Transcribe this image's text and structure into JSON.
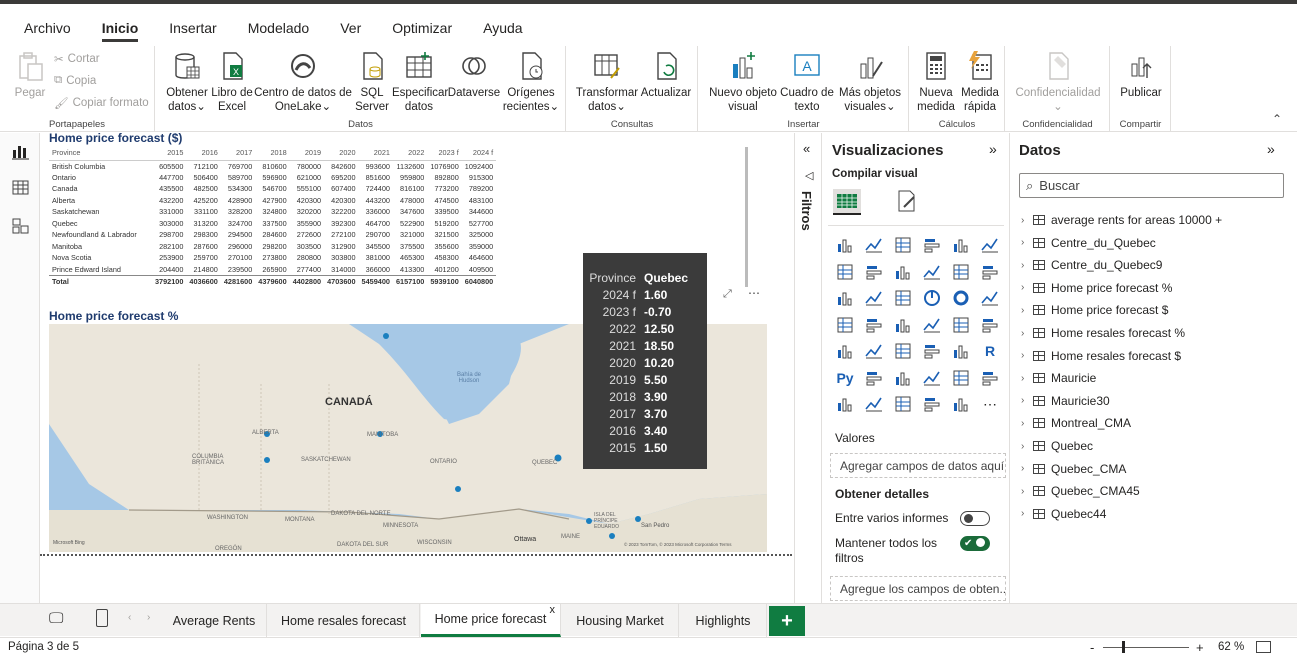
{
  "menu": [
    "Archivo",
    "Inicio",
    "Insertar",
    "Modelado",
    "Ver",
    "Optimizar",
    "Ayuda"
  ],
  "ribbon": {
    "portapapeles": {
      "label": "Portapapeles",
      "pegar": "Pegar",
      "cortar": "Cortar",
      "copia": "Copia",
      "copiar_formato": "Copiar formato"
    },
    "datos": {
      "label": "Datos",
      "obtener": "Obtener datos",
      "libro": "Libro de Excel",
      "centro": "Centro de datos de OneLake",
      "sql": "SQL Server",
      "especificar": "Especificar datos",
      "dataverse": "Dataverse",
      "origenes": "Orígenes recientes"
    },
    "consultas": {
      "label": "Consultas",
      "transformar": "Transformar datos",
      "actualizar": "Actualizar"
    },
    "insertar": {
      "label": "Insertar",
      "nuevo": "Nuevo objeto visual",
      "cuadro": "Cuadro de texto",
      "mas": "Más objetos visuales"
    },
    "calculos": {
      "label": "Cálculos",
      "nueva_medida": "Nueva medida",
      "medida_rapida": "Medida rápida"
    },
    "confidencialidad": {
      "label": "Confidencialidad",
      "btn": "Confidencialidad"
    },
    "compartir": {
      "label": "Compartir",
      "publicar": "Publicar"
    }
  },
  "table": {
    "title": "Home price forecast ($)",
    "headers": [
      "Province",
      "2015",
      "2016",
      "2017",
      "2018",
      "2019",
      "2020",
      "2021",
      "2022",
      "2023 f",
      "2024 f"
    ],
    "rows": [
      [
        "British Columbia",
        "605500",
        "712100",
        "769700",
        "810600",
        "780000",
        "842600",
        "993600",
        "1132600",
        "1076900",
        "1092400"
      ],
      [
        "Ontario",
        "447700",
        "506400",
        "589700",
        "596900",
        "621000",
        "695200",
        "851600",
        "959800",
        "892800",
        "915300"
      ],
      [
        "Canada",
        "435500",
        "482500",
        "534300",
        "546700",
        "555100",
        "607400",
        "724400",
        "816100",
        "773200",
        "789200"
      ],
      [
        "Alberta",
        "432200",
        "425200",
        "428900",
        "427900",
        "420300",
        "420300",
        "443200",
        "478000",
        "474500",
        "483100"
      ],
      [
        "Saskatchewan",
        "331000",
        "331100",
        "328200",
        "324800",
        "320200",
        "322200",
        "336000",
        "347600",
        "339500",
        "344600"
      ],
      [
        "Quebec",
        "303000",
        "313200",
        "324700",
        "337500",
        "355900",
        "392300",
        "464700",
        "522900",
        "519200",
        "527700"
      ],
      [
        "Newfoundland & Labrador",
        "298700",
        "298300",
        "294500",
        "284600",
        "272600",
        "272100",
        "290700",
        "321000",
        "321500",
        "325000"
      ],
      [
        "Manitoba",
        "282100",
        "287600",
        "296000",
        "298200",
        "303500",
        "312900",
        "345500",
        "375500",
        "355600",
        "359000"
      ],
      [
        "Nova Scotia",
        "253900",
        "259700",
        "270100",
        "273800",
        "280800",
        "303800",
        "381000",
        "465300",
        "458300",
        "464600"
      ],
      [
        "Prince Edward Island",
        "204400",
        "214800",
        "239500",
        "265900",
        "277400",
        "314000",
        "366000",
        "413300",
        "401200",
        "409500"
      ]
    ],
    "total": [
      "Total",
      "3792100",
      "4036600",
      "4281600",
      "4379600",
      "4402800",
      "4703600",
      "5459400",
      "6157100",
      "5939100",
      "6040800"
    ]
  },
  "map": {
    "title": "Home price forecast %",
    "labels": {
      "canada": "CANADÁ",
      "alberta": "ALBERTA",
      "manitoba": "MANITOBA",
      "sask": "SASKATCHEWAN",
      "ontario": "ONTARIO",
      "quebec": "QUEBEC",
      "bc": "COLUMBIA BRITÁNICA",
      "hudson": "Bahía de Hudson",
      "washington": "WASHINGTON",
      "montana": "MONTANA",
      "dakota_n": "DAKOTA DEL NORTE",
      "dakota_s": "DAKOTA DEL SUR",
      "minnesota": "MINNESOTA",
      "wisconsin": "WISCONSIN",
      "oregon": "OREGÓN",
      "maine": "MAINE",
      "ottawa": "Ottawa",
      "pei": "ISLA DEL PRÍNCIPE EDUARDO",
      "sanpedro": "San Pedro",
      "bing": "Microsoft Bing",
      "copyright": "© 2023 TomTom, © 2023 Microsoft Corporation  Terms"
    }
  },
  "tooltip": {
    "province_label": "Province",
    "province": "Quebec",
    "rows": [
      [
        "2024 f",
        "1.60"
      ],
      [
        "2023 f",
        "-0.70"
      ],
      [
        "2022",
        "12.50"
      ],
      [
        "2021",
        "18.50"
      ],
      [
        "2020",
        "10.20"
      ],
      [
        "2019",
        "5.50"
      ],
      [
        "2018",
        "3.90"
      ],
      [
        "2017",
        "3.70"
      ],
      [
        "2016",
        "3.40"
      ],
      [
        "2015",
        "1.50"
      ]
    ]
  },
  "filters": {
    "label": "Filtros"
  },
  "viz": {
    "title": "Visualizaciones",
    "compilar": "Compilar visual",
    "valores": "Valores",
    "agregar": "Agregar campos de datos aquí",
    "obtener_detalles": "Obtener detalles",
    "entre": "Entre varios informes",
    "mantener": "Mantener todos los filtros",
    "agregue": "Agregue los campos de obten..."
  },
  "datos": {
    "title": "Datos",
    "search": "Buscar",
    "items": [
      "average rents for areas 10000 +",
      "Centre_du_Quebec",
      "Centre_du_Quebec9",
      "Home price forecast %",
      "Home price forecast $",
      "Home resales forecast %",
      "Home resales forecast $",
      "Mauricie",
      "Mauricie30",
      "Montreal_CMA",
      "Quebec",
      "Quebec_CMA",
      "Quebec_CMA45",
      "Quebec44"
    ]
  },
  "tabs": [
    "Average Rents",
    "Home resales forecast",
    "Home price forecast",
    "Housing Market",
    "Highlights"
  ],
  "status": {
    "page": "Página 3 de 5",
    "zoom": "62 %"
  }
}
